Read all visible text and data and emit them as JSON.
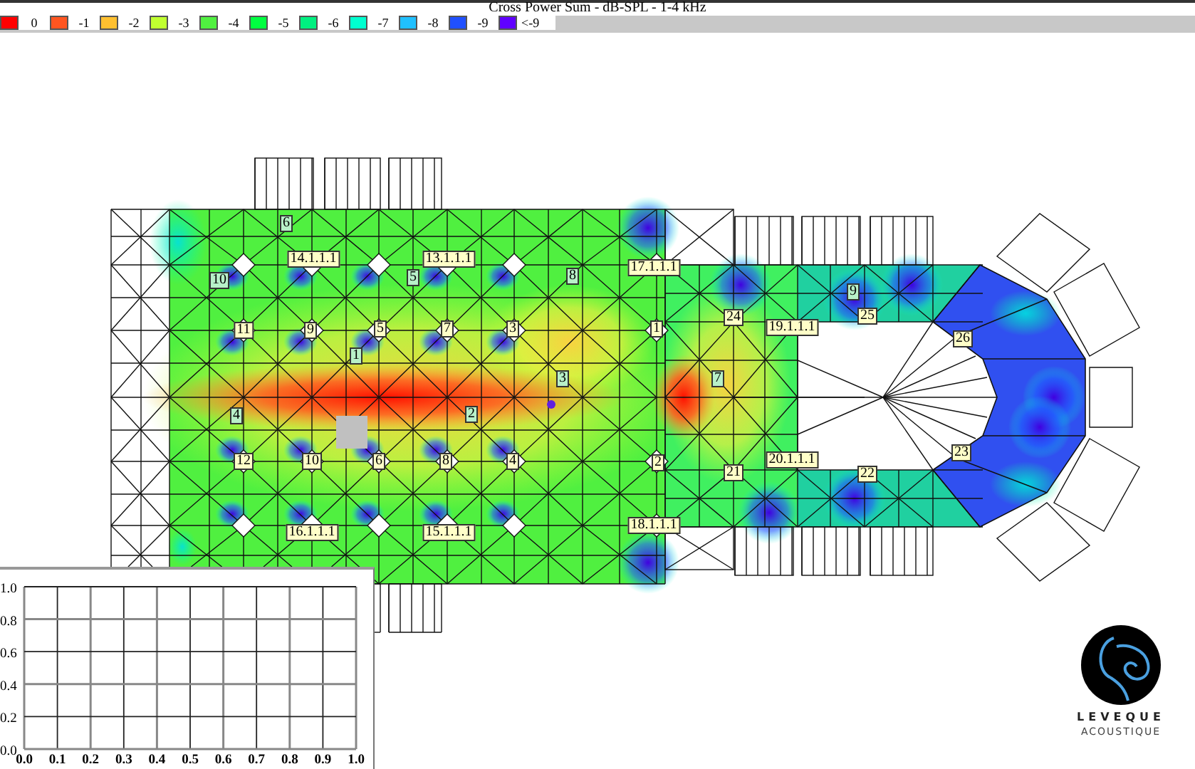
{
  "title": "Cross Power Sum - dB-SPL - 1-4 kHz",
  "legend": [
    {
      "label": "0",
      "color": "#ff0000"
    },
    {
      "label": "-1",
      "color": "#ff5520"
    },
    {
      "label": "-2",
      "color": "#ffc030"
    },
    {
      "label": "-3",
      "color": "#c0ff30"
    },
    {
      "label": "-4",
      "color": "#50f040"
    },
    {
      "label": "-5",
      "color": "#00ff40"
    },
    {
      "label": "-6",
      "color": "#00f080"
    },
    {
      "label": "-7",
      "color": "#00ffd0"
    },
    {
      "label": "-8",
      "color": "#20c0ff"
    },
    {
      "label": "-9",
      "color": "#2050ff"
    },
    {
      "label": "<-9",
      "color": "#6000ff"
    }
  ],
  "markers": [
    {
      "text": "6",
      "kind": "receiver"
    },
    {
      "text": "14.1.1.1",
      "kind": "source"
    },
    {
      "text": "13.1.1.1",
      "kind": "source"
    },
    {
      "text": "17.1.1.1",
      "kind": "source"
    },
    {
      "text": "10",
      "kind": "receiver"
    },
    {
      "text": "5",
      "kind": "receiver"
    },
    {
      "text": "8",
      "kind": "receiver"
    },
    {
      "text": "9",
      "kind": "receiver"
    },
    {
      "text": "24",
      "kind": "source"
    },
    {
      "text": "25",
      "kind": "source"
    },
    {
      "text": "11",
      "kind": "source"
    },
    {
      "text": "9",
      "kind": "source"
    },
    {
      "text": "5",
      "kind": "source"
    },
    {
      "text": "7",
      "kind": "source"
    },
    {
      "text": "3",
      "kind": "source"
    },
    {
      "text": "1",
      "kind": "source"
    },
    {
      "text": "19.1.1.1",
      "kind": "source"
    },
    {
      "text": "26",
      "kind": "source"
    },
    {
      "text": "1",
      "kind": "receiver"
    },
    {
      "text": "3",
      "kind": "receiver"
    },
    {
      "text": "7",
      "kind": "receiver"
    },
    {
      "text": "4",
      "kind": "receiver"
    },
    {
      "text": "2",
      "kind": "receiver"
    },
    {
      "text": "23",
      "kind": "source"
    },
    {
      "text": "12",
      "kind": "source"
    },
    {
      "text": "10",
      "kind": "source"
    },
    {
      "text": "6",
      "kind": "source"
    },
    {
      "text": "8",
      "kind": "source"
    },
    {
      "text": "4",
      "kind": "source"
    },
    {
      "text": "2",
      "kind": "source"
    },
    {
      "text": "20.1.1.1",
      "kind": "source"
    },
    {
      "text": "21",
      "kind": "source"
    },
    {
      "text": "22",
      "kind": "source"
    },
    {
      "text": "18.1.1.1",
      "kind": "source"
    },
    {
      "text": "16.1.1.1",
      "kind": "source"
    },
    {
      "text": "15.1.1.1",
      "kind": "source"
    }
  ],
  "chart": {
    "chart_data": {
      "type": "line",
      "grid": true,
      "xlim": [
        0,
        1
      ],
      "ylim": [
        0,
        1
      ],
      "xticks": [
        {
          "value": 0,
          "label": "0.0"
        },
        {
          "value": 0.1,
          "label": "0.1"
        },
        {
          "value": 0.2,
          "label": "0.2"
        },
        {
          "value": 0.3,
          "label": "0.3"
        },
        {
          "value": 0.4,
          "label": "0.4"
        },
        {
          "value": 0.5,
          "label": "0.5"
        },
        {
          "value": 0.6,
          "label": "0.6"
        },
        {
          "value": 0.7,
          "label": "0.7"
        },
        {
          "value": 0.8,
          "label": "0.8"
        },
        {
          "value": 0.9,
          "label": "0.9"
        },
        {
          "value": 1,
          "label": "1.0"
        }
      ],
      "yticks": [
        {
          "value": 0,
          "label": "0.0"
        },
        {
          "value": 0.2,
          "label": "0.2"
        },
        {
          "value": 0.4,
          "label": "0.4"
        },
        {
          "value": 0.6,
          "label": "0.6"
        },
        {
          "value": 0.8,
          "label": "0.8"
        },
        {
          "value": 1,
          "label": "1.0"
        }
      ]
    }
  },
  "logo": {
    "name": "LEVEQUE",
    "subtitle": "ACOUSTIQUE"
  }
}
